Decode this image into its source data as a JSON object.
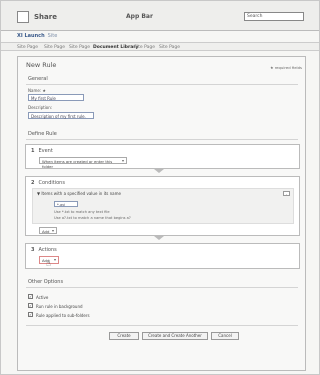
{
  "appbar": {
    "app_name": "Share",
    "title": "App Bar",
    "search_value": "Search"
  },
  "site": {
    "name": "XI Launch",
    "sub": "Site"
  },
  "tabs": [
    {
      "label": "Site Page"
    },
    {
      "label": "Site Page"
    },
    {
      "label": "Site Page"
    },
    {
      "label": "Document Library"
    },
    {
      "label": "Site Page"
    },
    {
      "label": "Site Page"
    }
  ],
  "page": {
    "title": "New Rule",
    "required_note": "★ required fields",
    "general_label": "General",
    "name_label": "Name: ★",
    "name_value": "My first Rule",
    "description_label": "Description:",
    "description_value": "Description of my first rule.",
    "define_rule_label": "Define Rule",
    "event": {
      "number": "1",
      "title": "Event",
      "select_value": "When items are created or enter this folder"
    },
    "conditions": {
      "number": "2",
      "title": "Conditions",
      "condition_title": "▼  Items with a specified value in its name",
      "close_label": "-",
      "input_value": "*.avi",
      "hint_1": "Use *.txt to match any text file",
      "hint_2": "Use a?.txt to match a name that begins a?",
      "add_label": "Add"
    },
    "actions": {
      "number": "3",
      "title": "Actions",
      "add_label": "Add"
    },
    "other_options_label": "Other Options",
    "options": [
      {
        "label": "Active",
        "checked": "✓"
      },
      {
        "label": "Run rule in background",
        "checked": "✓"
      },
      {
        "label": "Rule applied to sub-folders",
        "checked": "✓"
      }
    ],
    "buttons": {
      "create": "Create",
      "create_another": "Create and Create Another",
      "cancel": "Cancel"
    }
  }
}
